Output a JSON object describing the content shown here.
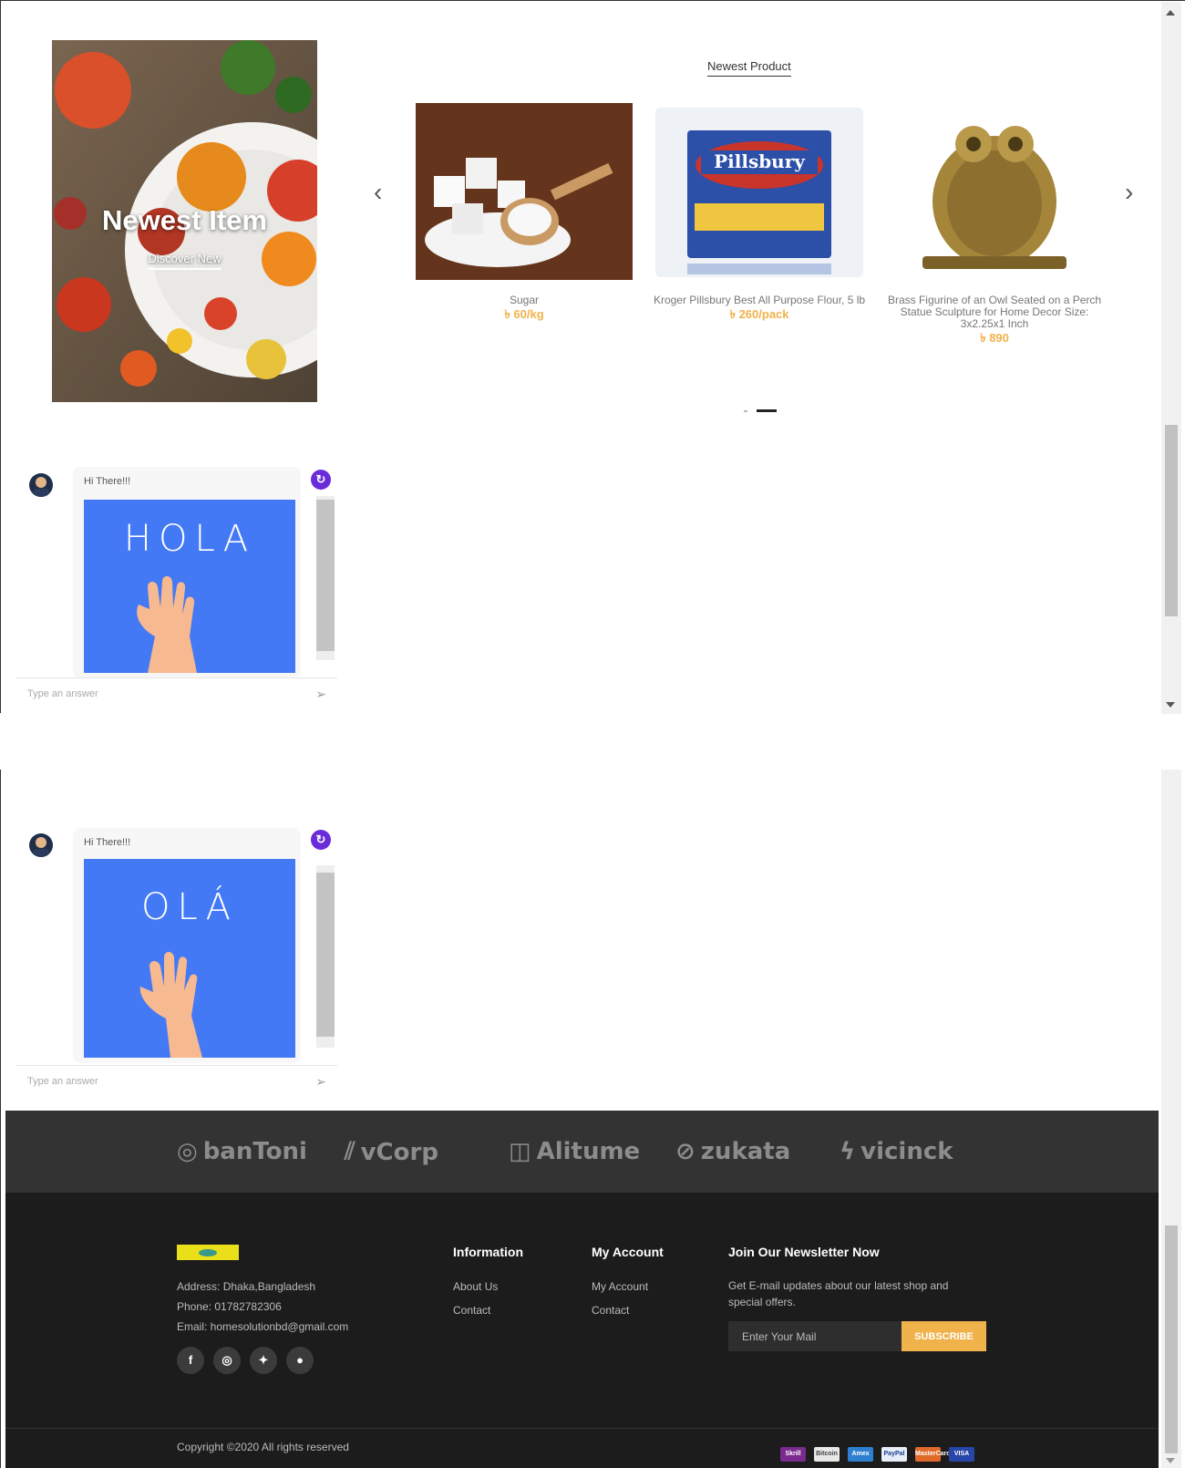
{
  "banner": {
    "title": "Newest Item",
    "link": "Discover New"
  },
  "section_title": "Newest Product",
  "products": [
    {
      "name": "Sugar",
      "price": "৳ 60/kg"
    },
    {
      "name": "Kroger Pillsbury Best All Purpose Flour, 5 lb",
      "price": "৳ 260/pack"
    },
    {
      "name": "Brass Figurine of an Owl Seated on a Perch Statue Sculpture for Home Decor Size: 3x2.25x1 Inch",
      "price": "৳ 890"
    }
  ],
  "chat": [
    {
      "greeting": "Hi There!!!",
      "image_text": "HOLA",
      "placeholder": "Type an answer"
    },
    {
      "greeting": "Hi There!!!",
      "image_text": "OLÁ",
      "placeholder": "Type an answer"
    }
  ],
  "brands": [
    "banToni",
    "vCorp",
    "Alitume",
    "zukata",
    "vicinck"
  ],
  "footer": {
    "address": "Address: Dhaka,Bangladesh",
    "phone": "Phone: 01782782306",
    "email": "Email: homesolutionbd@gmail.com",
    "information": {
      "title": "Information",
      "links": [
        "About Us",
        "Contact"
      ]
    },
    "account": {
      "title": "My Account",
      "links": [
        "My Account",
        "Contact"
      ]
    },
    "newsletter": {
      "title": "Join Our Newsletter Now",
      "text_line1": "Get E-mail updates about our latest shop and",
      "text_line2": "special offers.",
      "placeholder": "Enter Your Mail",
      "button": "SUBSCRIBE"
    },
    "copyright": "Copyright ©2020 All rights reserved",
    "payments": [
      "Skrill",
      "Bitcoin",
      "Amex",
      "PayPal",
      "MasterCard",
      "VISA"
    ],
    "social_icons": [
      "facebook-icon",
      "instagram-icon",
      "twitter-icon",
      "pinterest-icon"
    ]
  },
  "colors": {
    "accent": "#f0b24b",
    "chat_image": "#4479f5",
    "chat_badge": "#6a2cd8",
    "footer_bg": "#1c1c1c",
    "brand_bar": "#333333"
  }
}
